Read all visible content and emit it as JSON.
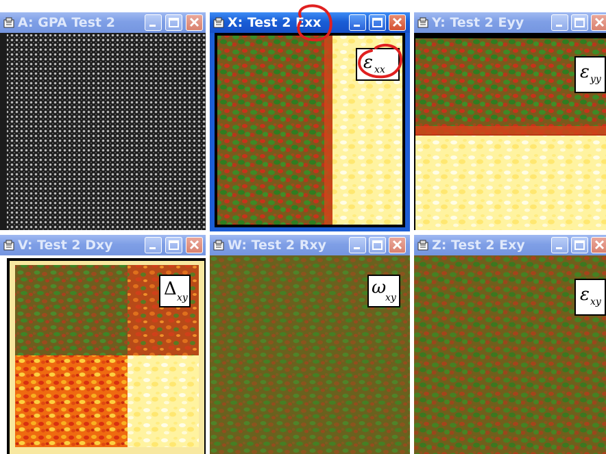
{
  "windows": [
    {
      "id": "A",
      "title": "A: GPA Test 2",
      "state": "inactive"
    },
    {
      "id": "X",
      "title": "X: Test 2 Exx",
      "state": "active",
      "label_main": "ε",
      "label_sub": "xx"
    },
    {
      "id": "Y",
      "title": "Y: Test 2 Eyy",
      "state": "inactive",
      "label_main": "ε",
      "label_sub": "yy"
    },
    {
      "id": "V",
      "title": "V: Test 2 Dxy",
      "state": "inactive",
      "label_main": "Δ",
      "label_sub": "xy"
    },
    {
      "id": "W",
      "title": "W: Test 2 Rxy",
      "state": "inactive",
      "label_main": "ω",
      "label_sub": "xy"
    },
    {
      "id": "Z",
      "title": "Z: Test 2 Exy",
      "state": "inactive",
      "label_main": "ε",
      "label_sub": "xy"
    }
  ],
  "icons": {
    "window": "window-app-icon",
    "minimize": "minimize-icon",
    "maximize": "maximize-icon",
    "close": "close-icon"
  },
  "colors": {
    "active_title": "#1a5ed6",
    "inactive_title": "#7f9fe6",
    "annotation": "#e02020",
    "map_green": "#3c8a2a",
    "map_red": "#c8321a",
    "map_yellow": "#fff6b0"
  }
}
